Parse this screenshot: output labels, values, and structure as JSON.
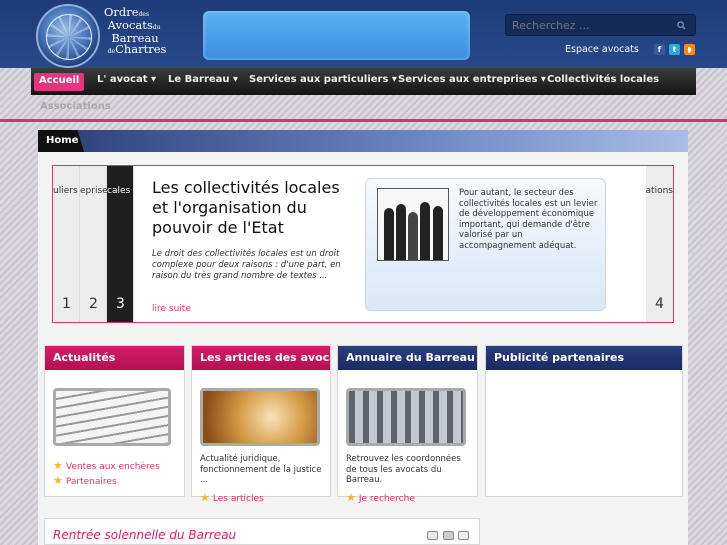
{
  "header": {
    "logo_lines": [
      "Ordre",
      "des",
      "Avocats",
      "du",
      "Barreau",
      "de",
      "Chartres"
    ],
    "search_placeholder": "Recherchez ...",
    "espace_link": "Espace avocats",
    "social_icons": [
      "facebook-icon",
      "twitter-icon",
      "rss-icon"
    ]
  },
  "nav": {
    "items": [
      "Accueil",
      "L' avocat ▾",
      "Le Barreau ▾",
      "Services aux particuliers ▾",
      "Services aux entreprises ▾",
      "Collectivités locales"
    ],
    "row2": "Associations"
  },
  "breadcrumb": "Home",
  "slider": {
    "tabs": [
      {
        "label": "uliers",
        "num": "1"
      },
      {
        "label": "eprises",
        "num": "2"
      },
      {
        "label": "cales",
        "num": "3"
      },
      {
        "label": "ations",
        "num": "4"
      }
    ],
    "title": "Les collectivités locales et l'organisation du pouvoir de l'Etat",
    "text": "Le droit des collectivités locales est un droit complexe pour deux raisons : d'une part, en raison du très grand nombre de textes ...",
    "more": "lire suite",
    "box_text": "Pour autant, le secteur des collectivités locales est un levier de développement économique important, qui demande d'être valorisé par un accompagnement adéquat."
  },
  "columns": [
    {
      "title": "Actualités",
      "links": [
        "Ventes aux enchères",
        "Partenaires"
      ]
    },
    {
      "title": "Les articles des avocats",
      "text": "Actualité juridique, fonctionnement de la justice ...",
      "link": "Les articles"
    },
    {
      "title": "Annuaire du Barreau",
      "text": "Retrouvez les coordonnées de tous les avocats du Barreau.",
      "link": "Je recherche"
    },
    {
      "title": "Publicité partenaires"
    }
  ],
  "bottom": {
    "title": "Rentrée solennelle du Barreau"
  },
  "colors": {
    "accent": "#e0306f",
    "navy": "#1e3b78",
    "nav_dark": "#1a1a1a"
  }
}
